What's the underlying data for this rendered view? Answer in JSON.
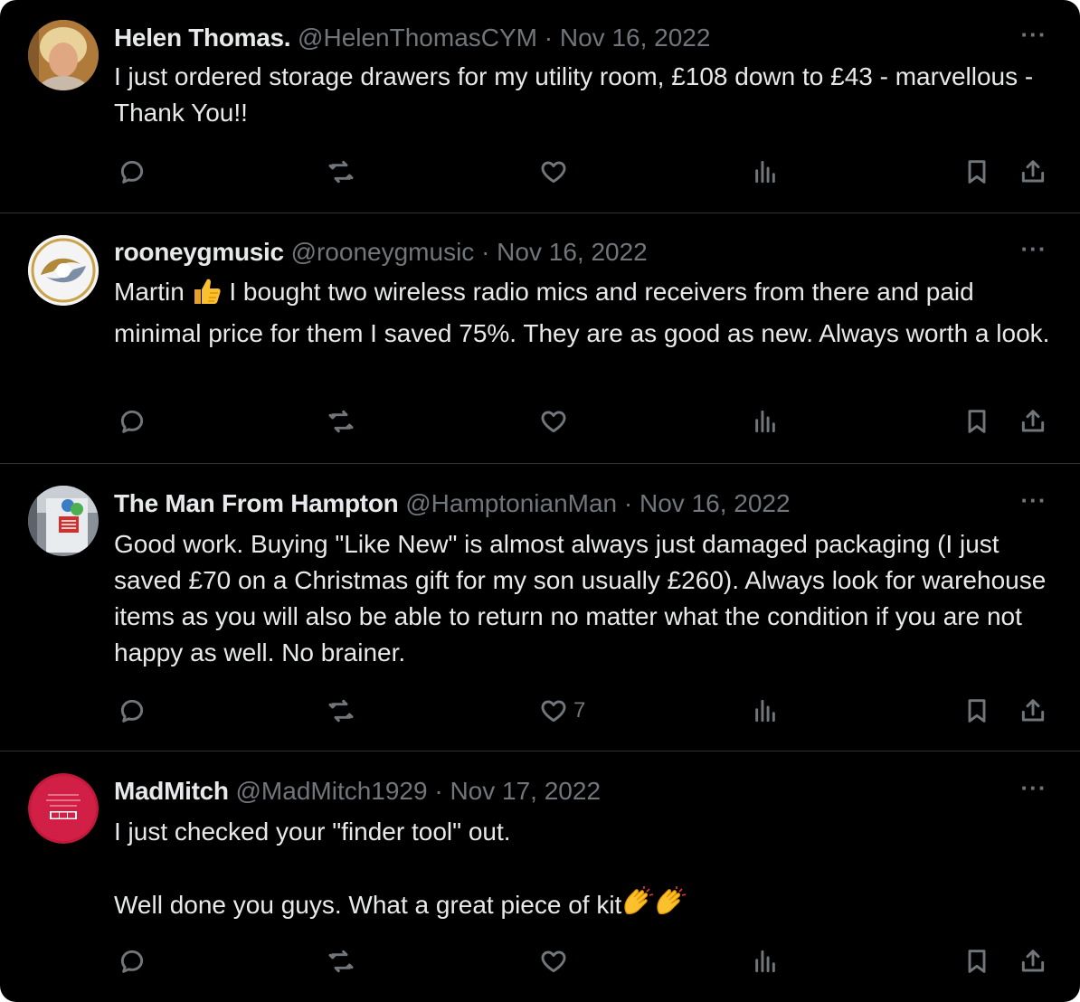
{
  "tweets": [
    {
      "name": "Helen Thomas.",
      "handle": "@HelenThomasCYM",
      "date": "· Nov 16, 2022",
      "more": "···",
      "text": [
        "I just ordered storage drawers for my utility room, £108 down to £43 - marvellous - Thank You!!"
      ],
      "likes": ""
    },
    {
      "name": "rooneygmusic",
      "handle": "@rooneygmusic",
      "date": "· Nov 16, 2022",
      "more": "···",
      "text_before_emoji": "Martin ",
      "emoji": "thumbs-up",
      "text_after_emoji": " I bought two wireless radio mics and receivers from there and paid minimal price for them I saved 75%.  They are as good as new.  Always worth a look.",
      "likes": ""
    },
    {
      "name": "The Man From Hampton",
      "handle": "@HamptonianMan",
      "date": "· Nov 16, 2022",
      "more": "···",
      "text": [
        "Good work. Buying \"Like New\" is almost always just damaged packaging (I just saved £70 on a Christmas gift for my son usually £260). Always look for warehouse items as you will also be able to return no matter what the condition if you are not happy as well. No brainer."
      ],
      "likes": "7"
    },
    {
      "name": "MadMitch",
      "handle": "@MadMitch1929",
      "date": "· Nov 17, 2022",
      "more": "···",
      "text": [
        "I just checked your \"finder tool\" out.",
        "Well done you guys. What a great piece of kit"
      ],
      "emoji": "clapping-hands",
      "likes": ""
    }
  ],
  "colors": {
    "background": "#000000",
    "primary_text": "#e7e9ea",
    "secondary_text": "#71767b",
    "divider": "#2f3336"
  },
  "icons": [
    "reply-icon",
    "retweet-icon",
    "like-icon",
    "views-icon",
    "bookmark-icon",
    "share-icon"
  ]
}
